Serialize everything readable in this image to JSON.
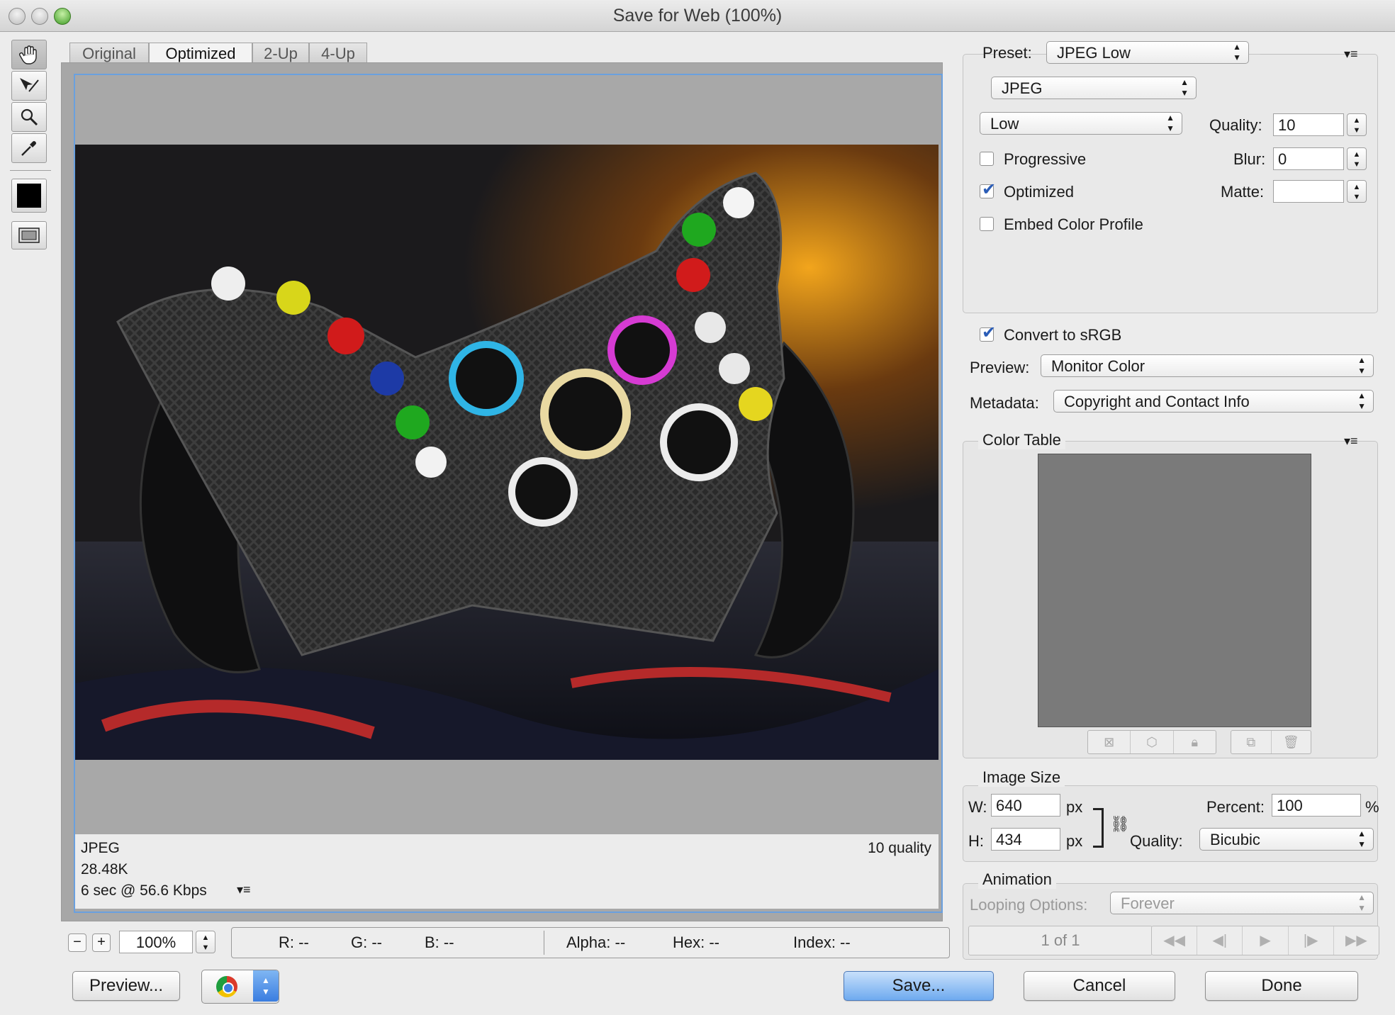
{
  "window": {
    "title": "Save for Web (100%)"
  },
  "tabs": [
    "Original",
    "Optimized",
    "2-Up",
    "4-Up"
  ],
  "selected_tab": "Optimized",
  "image_info": {
    "format": "JPEG",
    "size": "28.48K",
    "speed": "6 sec @ 56.6 Kbps",
    "quality_note": "10 quality"
  },
  "zoom": {
    "value": "100%"
  },
  "pixel_readout": {
    "r": "R: --",
    "g": "G: --",
    "b": "B: --",
    "alpha": "Alpha: --",
    "hex": "Hex: --",
    "index": "Index: --"
  },
  "buttons": {
    "preview": "Preview...",
    "save": "Save...",
    "cancel": "Cancel",
    "done": "Done"
  },
  "preset": {
    "label": "Preset:",
    "value": "JPEG Low"
  },
  "format": {
    "value": "JPEG"
  },
  "compression": {
    "value": "Low"
  },
  "quality": {
    "label": "Quality:",
    "value": "10"
  },
  "blur": {
    "label": "Blur:",
    "value": "0"
  },
  "matte": {
    "label": "Matte:",
    "value": ""
  },
  "options": {
    "progressive": {
      "label": "Progressive",
      "checked": false
    },
    "optimized": {
      "label": "Optimized",
      "checked": true
    },
    "embed": {
      "label": "Embed Color Profile",
      "checked": false
    },
    "srgb": {
      "label": "Convert to sRGB",
      "checked": true
    }
  },
  "preview_mode": {
    "label": "Preview:",
    "value": "Monitor Color"
  },
  "metadata": {
    "label": "Metadata:",
    "value": "Copyright and Contact Info"
  },
  "color_table": {
    "title": "Color Table"
  },
  "image_size": {
    "title": "Image Size",
    "w_label": "W:",
    "w_value": "640",
    "h_label": "H:",
    "h_value": "434",
    "unit": "px",
    "percent_label": "Percent:",
    "percent_value": "100",
    "percent_unit": "%",
    "quality_label": "Quality:",
    "quality_value": "Bicubic"
  },
  "animation": {
    "title": "Animation",
    "looping_label": "Looping Options:",
    "looping_value": "Forever",
    "frame": "1 of 1"
  },
  "colors": {
    "accent": "#6aa0df",
    "save_button": "#6eaaef"
  }
}
